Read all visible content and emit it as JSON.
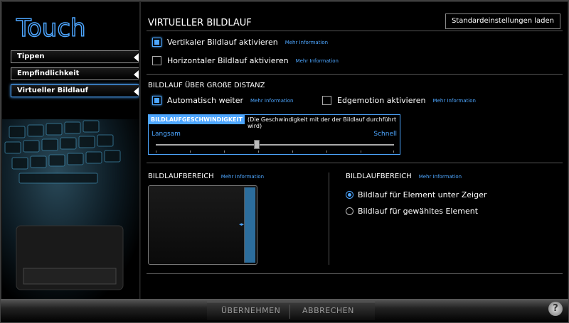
{
  "app": {
    "logo_text": "Touch"
  },
  "sidebar": {
    "items": [
      {
        "label": "Tippen"
      },
      {
        "label": "Empfindlichkeit"
      },
      {
        "label": "Virtueller Bildlauf"
      }
    ]
  },
  "main": {
    "title": "VIRTUELLER BILDLAUF",
    "default_button": "Standardeinstellungen laden",
    "vertical_label": "Vertikaler Bildlauf aktivieren",
    "horizontal_label": "Horizontaler Bildlauf aktivieren",
    "more_info": "Mehr Information",
    "long_distance_title": "BILDLAUF ÜBER GROßE DISTANZ",
    "auto_label": "Automatisch weiter",
    "edgemotion_label": "Edgemotion aktivieren",
    "speed": {
      "title": "BILDLAUFGESCHWINDIGKEIT",
      "desc": "(Die Geschwindigkeit mit der der Bildlauf durchführt wird)",
      "slow": "Langsam",
      "fast": "Schnell",
      "level": 0.42
    },
    "scroll_area_title": "BILDLAUFBEREICH",
    "scroll_area_right_title": "BILDLAUFBEREICH",
    "radio_under_pointer": "Bildlauf für Element unter Zeiger",
    "radio_selected": "Bildlauf für gewähltes Element"
  },
  "footer": {
    "apply": "ÜBERNEHMEN",
    "cancel": "ABBRECHEN",
    "help": "?"
  },
  "colors": {
    "accent": "#4da6ff"
  }
}
